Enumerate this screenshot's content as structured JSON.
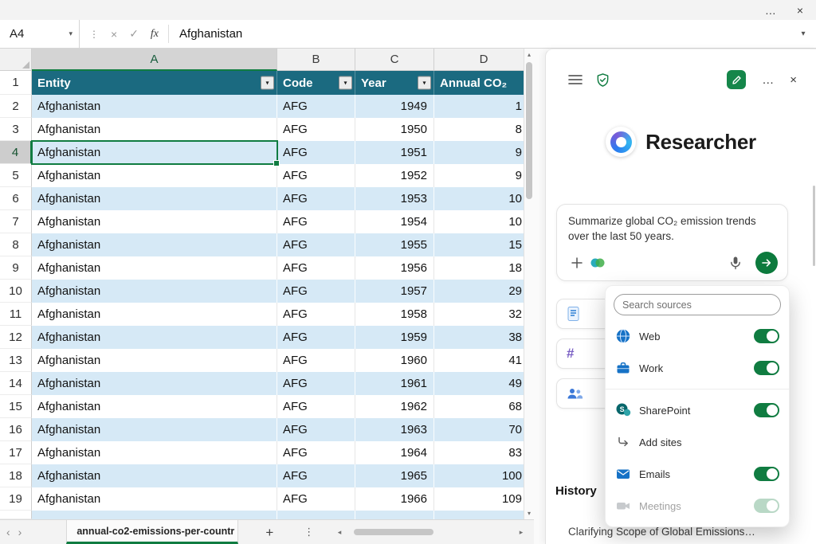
{
  "colors": {
    "accent_green": "#107C41",
    "table_header_teal": "#1b6a80",
    "band_blue": "#d6e9f6",
    "send_green": "#0c7a3d"
  },
  "icons": {
    "more": "…",
    "close": "×",
    "cancel": "×",
    "check": "✓",
    "kebab": "⋮",
    "chevron_down": "▾",
    "filter_arrow": "▾",
    "scroll_up": "▴",
    "scroll_down": "▾",
    "scroll_left": "◂",
    "scroll_right": "▸",
    "tab_prev": "‹",
    "tab_next": "›"
  },
  "formula_bar": {
    "name_box_value": "A4",
    "fx_label": "fx",
    "formula_value": "Afghanistan"
  },
  "grid": {
    "column_headers": [
      "A",
      "B",
      "C",
      "D"
    ],
    "selected_column": "A",
    "selected_row": 4,
    "header_row": {
      "num": "1",
      "cells": [
        "Entity",
        "Code",
        "Year",
        "Annual CO₂"
      ]
    },
    "rows": [
      {
        "num": 2,
        "entity": "Afghanistan",
        "code": "AFG",
        "year": "1949",
        "d": "1"
      },
      {
        "num": 3,
        "entity": "Afghanistan",
        "code": "AFG",
        "year": "1950",
        "d": "8"
      },
      {
        "num": 4,
        "entity": "Afghanistan",
        "code": "AFG",
        "year": "1951",
        "d": "9"
      },
      {
        "num": 5,
        "entity": "Afghanistan",
        "code": "AFG",
        "year": "1952",
        "d": "9"
      },
      {
        "num": 6,
        "entity": "Afghanistan",
        "code": "AFG",
        "year": "1953",
        "d": "10"
      },
      {
        "num": 7,
        "entity": "Afghanistan",
        "code": "AFG",
        "year": "1954",
        "d": "10"
      },
      {
        "num": 8,
        "entity": "Afghanistan",
        "code": "AFG",
        "year": "1955",
        "d": "15"
      },
      {
        "num": 9,
        "entity": "Afghanistan",
        "code": "AFG",
        "year": "1956",
        "d": "18"
      },
      {
        "num": 10,
        "entity": "Afghanistan",
        "code": "AFG",
        "year": "1957",
        "d": "29"
      },
      {
        "num": 11,
        "entity": "Afghanistan",
        "code": "AFG",
        "year": "1958",
        "d": "32"
      },
      {
        "num": 12,
        "entity": "Afghanistan",
        "code": "AFG",
        "year": "1959",
        "d": "38"
      },
      {
        "num": 13,
        "entity": "Afghanistan",
        "code": "AFG",
        "year": "1960",
        "d": "41"
      },
      {
        "num": 14,
        "entity": "Afghanistan",
        "code": "AFG",
        "year": "1961",
        "d": "49"
      },
      {
        "num": 15,
        "entity": "Afghanistan",
        "code": "AFG",
        "year": "1962",
        "d": "68"
      },
      {
        "num": 16,
        "entity": "Afghanistan",
        "code": "AFG",
        "year": "1963",
        "d": "70"
      },
      {
        "num": 17,
        "entity": "Afghanistan",
        "code": "AFG",
        "year": "1964",
        "d": "83"
      },
      {
        "num": 18,
        "entity": "Afghanistan",
        "code": "AFG",
        "year": "1965",
        "d": "100"
      },
      {
        "num": 19,
        "entity": "Afghanistan",
        "code": "AFG",
        "year": "1966",
        "d": "109"
      }
    ]
  },
  "sheet_bar": {
    "tab_name": "annual-co2-emissions-per-countr",
    "add_icon": "+"
  },
  "panel": {
    "title": "Researcher",
    "prompt_card": {
      "text": "Summarize global CO₂ emission trends over the last 50 years."
    },
    "suggestion_chips": [
      {
        "icon": "document-icon"
      },
      {
        "icon": "channel-hash-icon"
      },
      {
        "icon": "people-icon"
      }
    ],
    "sources_popup": {
      "search_placeholder": "Search sources",
      "items": [
        {
          "label": "Web",
          "icon": "globe-icon",
          "toggle": "on"
        },
        {
          "label": "Work",
          "icon": "briefcase-icon",
          "toggle": "on"
        },
        {
          "label": "SharePoint",
          "icon": "sharepoint-icon",
          "toggle": "on",
          "divider_before": true
        },
        {
          "label": "Add sites",
          "icon": "branch-arrow-icon",
          "toggle": "none"
        },
        {
          "label": "Emails",
          "icon": "mail-icon",
          "toggle": "on"
        },
        {
          "label": "Meetings",
          "icon": "camera-icon",
          "toggle": "disabled"
        }
      ]
    },
    "history": {
      "heading": "History",
      "items": [
        "Clarifying Scope of Global Emissions…"
      ]
    }
  }
}
